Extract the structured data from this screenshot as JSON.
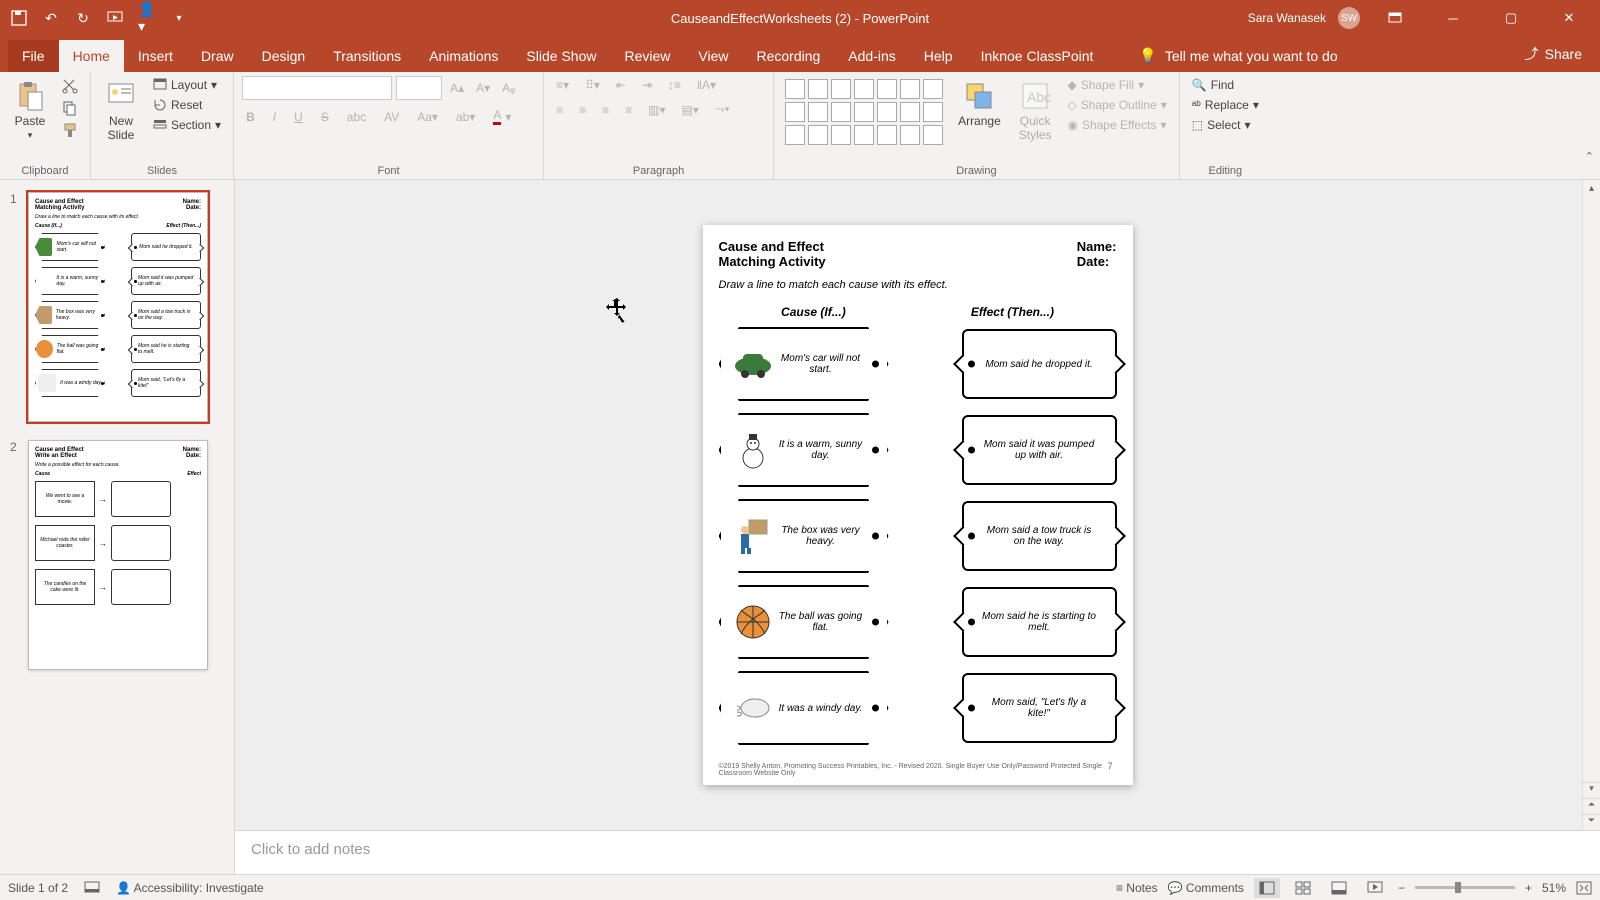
{
  "title_bar": {
    "doc_title": "CauseandEffectWorksheets (2) - PowerPoint",
    "user_name": "Sara Wanasek",
    "user_initials": "SW"
  },
  "ribbon_tabs": {
    "file": "File",
    "home": "Home",
    "insert": "Insert",
    "draw": "Draw",
    "design": "Design",
    "transitions": "Transitions",
    "animations": "Animations",
    "slideshow": "Slide Show",
    "review": "Review",
    "view": "View",
    "recording": "Recording",
    "addins": "Add-ins",
    "help": "Help",
    "classpoint": "Inknoe ClassPoint",
    "tellme": "Tell me what you want to do",
    "share": "Share"
  },
  "ribbon": {
    "clipboard": {
      "paste": "Paste",
      "label": "Clipboard"
    },
    "slides": {
      "new_slide": "New\nSlide",
      "layout": "Layout",
      "reset": "Reset",
      "section": "Section",
      "label": "Slides"
    },
    "font": {
      "label": "Font"
    },
    "paragraph": {
      "label": "Paragraph"
    },
    "drawing": {
      "arrange": "Arrange",
      "quick_styles": "Quick\nStyles",
      "shape_fill": "Shape Fill",
      "shape_outline": "Shape Outline",
      "shape_effects": "Shape Effects",
      "label": "Drawing"
    },
    "editing": {
      "find": "Find",
      "replace": "Replace",
      "select": "Select",
      "label": "Editing"
    }
  },
  "thumbnails": {
    "t1": {
      "num": "1",
      "title": "Cause and Effect\nMatching Activity",
      "name": "Name:",
      "date": "Date:",
      "instr": "Draw a line to match each cause with its effect.",
      "col1": "Cause (If...)",
      "col2": "Effect (Then...)",
      "causes": [
        "Mom's car will not start.",
        "It is a warm, sunny day.",
        "The box was very heavy.",
        "The ball was going flat.",
        "It was a windy day."
      ],
      "effects": [
        "Mom said he dropped it.",
        "Mom said it was pumped up with air.",
        "Mom said a tow truck is on the way.",
        "Mom said he is starting to melt.",
        "Mom said, \"Let's fly a kite!\""
      ]
    },
    "t2": {
      "num": "2",
      "title": "Cause and Effect\nWrite an Effect",
      "name": "Name:",
      "date": "Date:",
      "instr": "Write a possible effect for each cause.",
      "col1": "Cause",
      "col2": "Effect",
      "causes": [
        "We went to see a movie.",
        "Michael rode the roller coaster.",
        "The candles on the cake were lit."
      ]
    }
  },
  "slide": {
    "title": "Cause and Effect\nMatching Activity",
    "name_label": "Name:",
    "date_label": "Date:",
    "instr": "Draw a line to match each cause with its effect.",
    "cause_header": "Cause (If...)",
    "effect_header": "Effect (Then...)",
    "rows": [
      {
        "cause": "Mom's car will not start.",
        "effect": "Mom said he dropped it."
      },
      {
        "cause": "It is a warm, sunny day.",
        "effect": "Mom said it was pumped up with air."
      },
      {
        "cause": "The box was very heavy.",
        "effect": "Mom said a tow truck is on the way."
      },
      {
        "cause": "The ball was going flat.",
        "effect": "Mom said he is starting to melt."
      },
      {
        "cause": "It was a windy day.",
        "effect": "Mom said, \"Let's fly a kite!\""
      }
    ],
    "footer": "©2019 Shelly Anton, Promoting Success Printables, Inc. - Revised 2020. Single Buyer Use Only/Password Protected Single Classroom Website Only",
    "page_num": "7"
  },
  "notes": {
    "placeholder": "Click to add notes"
  },
  "status": {
    "slide_count": "Slide 1 of 2",
    "accessibility": "Accessibility: Investigate",
    "notes": "Notes",
    "comments": "Comments",
    "zoom": "51%"
  }
}
